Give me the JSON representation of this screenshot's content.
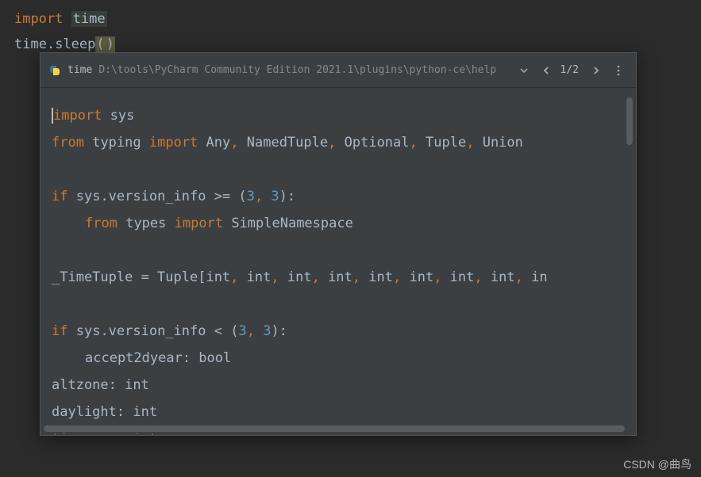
{
  "editor": {
    "line1": {
      "kw": "import",
      "mod": "time"
    },
    "line2": {
      "obj": "time",
      "dot": ".",
      "fn": "sleep",
      "lp": "(",
      "rp": ")"
    }
  },
  "popup_header": {
    "module": "time",
    "path": "D:\\tools\\PyCharm Community Edition 2021.1\\plugins\\python-ce\\help",
    "pager": "1/2"
  },
  "doc": {
    "l1": {
      "kw": "import",
      "mod": "sys"
    },
    "l2": {
      "kw1": "from",
      "mod": "typing",
      "kw2": "import",
      "n1": "Any",
      "n2": "NamedTuple",
      "n3": "Optional",
      "n4": "Tuple",
      "n5": "Union"
    },
    "l3": {
      "kw": "if",
      "expr1": "sys.version_info >= (",
      "num1": "3",
      "c": ",",
      "sp": " ",
      "num2": "3",
      "expr2": "):"
    },
    "l4": {
      "kw1": "from",
      "mod": "types",
      "kw2": "import",
      "n": "SimpleNamespace"
    },
    "l5": {
      "lhs": "_TimeTuple = Tuple[int",
      "rep": ", int",
      "tail": ", in"
    },
    "l6": {
      "kw": "if",
      "expr1": "sys.version_info < (",
      "num1": "3",
      "c": ",",
      "sp": " ",
      "num2": "3",
      "expr2": "):"
    },
    "l7": {
      "txt": "accept2dyear: bool"
    },
    "l8": {
      "txt": "altzone: int"
    },
    "l9": {
      "txt": "daylight: int"
    },
    "l10": {
      "txt": "timezone: int"
    }
  },
  "watermark": "CSDN @曲鸟",
  "icons": {
    "python": "python-icon",
    "dropdown": "chevron-down-icon",
    "prev": "chevron-left-icon",
    "next": "chevron-right-icon",
    "more": "more-vertical-icon"
  }
}
